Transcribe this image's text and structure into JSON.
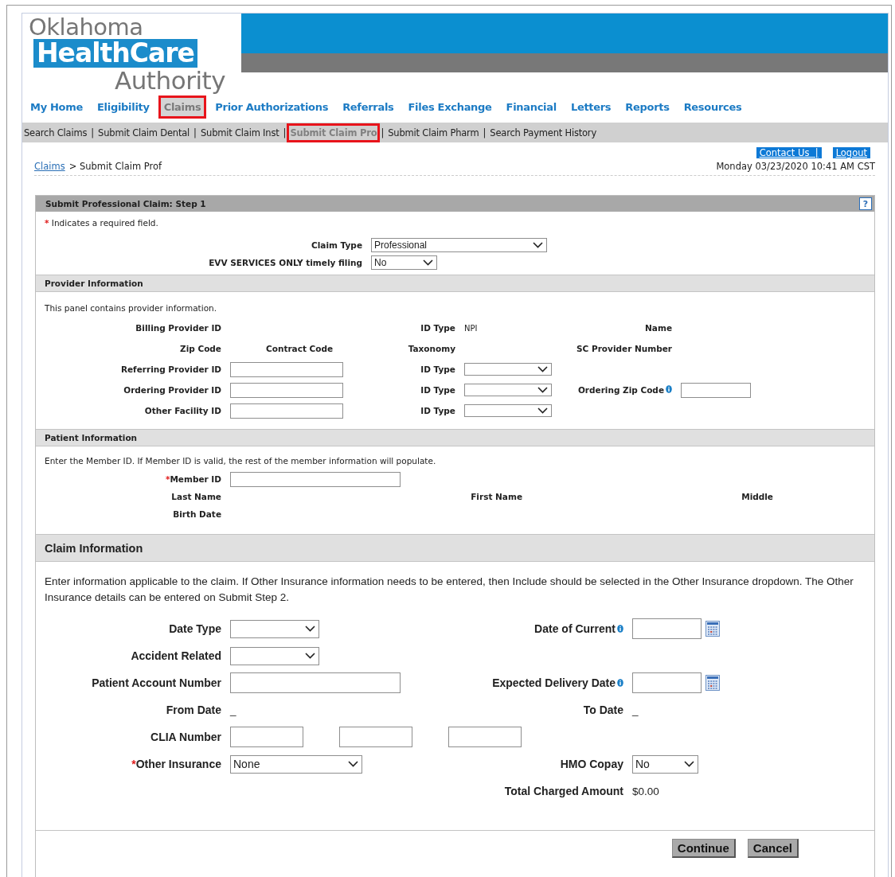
{
  "logo": {
    "line_1": "Oklahoma",
    "line_2": "HealthCare",
    "line_3": "Authority"
  },
  "nav": [
    {
      "label": "My Home",
      "selected": false,
      "highlighted": false
    },
    {
      "label": "Eligibility",
      "selected": false,
      "highlighted": false
    },
    {
      "label": "Claims",
      "selected": true,
      "highlighted": true
    },
    {
      "label": "Prior Authorizations",
      "selected": false,
      "highlighted": false
    },
    {
      "label": "Referrals",
      "selected": false,
      "highlighted": false
    },
    {
      "label": "Files Exchange",
      "selected": false,
      "highlighted": false
    },
    {
      "label": "Financial",
      "selected": false,
      "highlighted": false
    },
    {
      "label": "Letters",
      "selected": false,
      "highlighted": false
    },
    {
      "label": "Reports",
      "selected": false,
      "highlighted": false
    },
    {
      "label": "Resources",
      "selected": false,
      "highlighted": false
    }
  ],
  "subnav": {
    "separator": "|",
    "items": [
      {
        "label": "Search Claims",
        "selected": false,
        "highlighted": false
      },
      {
        "label": "Submit Claim Dental",
        "selected": false,
        "highlighted": false
      },
      {
        "label": "Submit Claim Inst",
        "selected": false,
        "highlighted": false
      },
      {
        "label": "Submit Claim Pro",
        "selected": true,
        "highlighted": true
      },
      {
        "label": "Submit Claim Pharm",
        "selected": false,
        "highlighted": false
      },
      {
        "label": "Search Payment History",
        "selected": false,
        "highlighted": false
      }
    ]
  },
  "top_links": [
    "Contact Us  |",
    "Logout"
  ],
  "breadcrumb": {
    "link": "Claims",
    "current": "> Submit Claim Prof"
  },
  "datetime": "Monday 03/23/2020 10:41 AM CST",
  "form": {
    "title": "Submit Professional Claim: Step 1",
    "help": "?",
    "required_mark": "*",
    "sections": [
      {
        "kind": "step",
        "note": "Indicates a required field.",
        "rows": [
          [
            {
              "kind": "pair",
              "label": "Claim Type",
              "required": false,
              "info": false,
              "controls": [
                {
                  "kind": "wide-select",
                  "value": "Professional"
                }
              ]
            }
          ],
          [
            {
              "kind": "pair",
              "label": "EVV SERVICES ONLY timely filing",
              "required": false,
              "info": false,
              "controls": [
                {
                  "kind": "short-select",
                  "value": "No"
                }
              ]
            }
          ]
        ]
      },
      {
        "kind": "provider",
        "title": "Provider Information",
        "description": "This panel contains provider information.",
        "rows": [
          [
            {
              "kind": "pair",
              "label": "Billing Provider ID",
              "required": false,
              "info": false
            },
            {
              "kind": "pair",
              "label": "ID Type",
              "required": false,
              "info": false,
              "controls": [
                {
                  "kind": "text",
                  "value": "NPI"
                }
              ]
            },
            {
              "kind": "pair",
              "label": "Name",
              "required": false,
              "info": false
            }
          ],
          [
            {
              "kind": "pair",
              "label": "Zip Code",
              "required": false,
              "info": false,
              "controls": [
                {
                  "kind": "label",
                  "value": "Contract Code"
                }
              ]
            },
            {
              "kind": "pair",
              "label": "Taxonomy",
              "required": false,
              "info": false
            },
            {
              "kind": "pair",
              "label": "SC Provider Number",
              "required": false,
              "info": false
            }
          ],
          [
            {
              "kind": "pair",
              "label": "Referring Provider ID",
              "required": false,
              "info": false,
              "controls": [
                {
                  "kind": "field"
                }
              ]
            },
            {
              "kind": "pair",
              "label": "ID Type",
              "required": false,
              "info": false,
              "controls": [
                {
                  "kind": "select"
                }
              ]
            }
          ],
          [
            {
              "kind": "pair",
              "label": "Ordering Provider ID",
              "required": false,
              "info": false,
              "controls": [
                {
                  "kind": "field"
                }
              ]
            },
            {
              "kind": "pair",
              "label": "ID Type",
              "required": false,
              "info": false,
              "controls": [
                {
                  "kind": "select"
                }
              ]
            },
            {
              "kind": "pair",
              "label": "Ordering Zip Code",
              "required": false,
              "info": true,
              "controls": [
                {
                  "kind": "short-field"
                }
              ]
            }
          ],
          [
            {
              "kind": "pair",
              "label": "Other Facility ID",
              "required": false,
              "info": false,
              "controls": [
                {
                  "kind": "field"
                }
              ]
            },
            {
              "kind": "pair",
              "label": "ID Type",
              "required": false,
              "info": false,
              "controls": [
                {
                  "kind": "select"
                }
              ]
            }
          ]
        ]
      },
      {
        "kind": "patient",
        "title": "Patient Information",
        "description": "Enter the Member ID. If Member ID is valid, the rest of the member information will populate.",
        "rows": [
          [
            {
              "kind": "pair",
              "label": "Member ID",
              "required": true,
              "info": false,
              "controls": [
                {
                  "kind": "long-field"
                }
              ]
            }
          ],
          [
            {
              "kind": "pair",
              "label": "Last Name",
              "required": false,
              "info": false
            },
            {
              "kind": "pair",
              "label": "First Name",
              "required": false,
              "info": false
            },
            {
              "kind": "pair",
              "label": "Middle",
              "required": false,
              "info": false
            }
          ],
          [
            {
              "kind": "pair",
              "label": "Birth Date",
              "required": false,
              "info": false
            }
          ]
        ]
      },
      {
        "kind": "claim",
        "title": "Claim Information",
        "description": "Enter information applicable to the claim. If Other Insurance information needs to be entered, then Include should be selected in the Other Insurance dropdown. The Other Insurance details can be entered on Submit Step 2.",
        "rows": [
          [
            {
              "kind": "pair",
              "label": "Date Type",
              "required": false,
              "info": false,
              "controls": [
                {
                  "kind": "select"
                }
              ]
            },
            {
              "kind": "pair",
              "label": "Date of Current",
              "required": false,
              "info": true,
              "controls": [
                {
                  "kind": "date-field"
                }
              ]
            }
          ],
          [
            {
              "kind": "pair",
              "label": "Accident Related",
              "required": false,
              "info": false,
              "controls": [
                {
                  "kind": "select"
                }
              ]
            }
          ],
          [
            {
              "kind": "pair",
              "label": "Patient Account Number",
              "required": false,
              "info": false,
              "controls": [
                {
                  "kind": "long-field"
                }
              ]
            },
            {
              "kind": "pair",
              "label": "Expected Delivery Date",
              "required": false,
              "info": true,
              "controls": [
                {
                  "kind": "date-field"
                }
              ]
            }
          ],
          [
            {
              "kind": "pair",
              "label": "From Date",
              "required": false,
              "info": false,
              "controls": [
                {
                  "kind": "text",
                  "value": "_"
                }
              ]
            },
            {
              "kind": "pair",
              "label": "To Date",
              "required": false,
              "info": false,
              "controls": [
                {
                  "kind": "text",
                  "value": "_"
                }
              ]
            }
          ],
          [
            {
              "kind": "pair",
              "label": "CLIA Number",
              "required": false,
              "info": false,
              "controls": [
                {
                  "kind": "short-field"
                },
                {
                  "kind": "short-field"
                },
                {
                  "kind": "short-field"
                }
              ]
            }
          ],
          [
            {
              "kind": "pair",
              "label": "Other Insurance",
              "required": true,
              "info": false,
              "controls": [
                {
                  "kind": "long-select",
                  "value": "None"
                }
              ]
            },
            {
              "kind": "pair",
              "label": "HMO Copay",
              "required": false,
              "info": false,
              "controls": [
                {
                  "kind": "short-select",
                  "value": "No"
                }
              ]
            }
          ],
          [
            {
              "kind": "blank"
            },
            {
              "kind": "pair",
              "label": "Total Charged Amount",
              "required": false,
              "info": false,
              "controls": [
                {
                  "kind": "text",
                  "value": "$0.00"
                }
              ]
            }
          ]
        ]
      }
    ]
  },
  "buttons": [
    "Continue",
    "Cancel"
  ]
}
